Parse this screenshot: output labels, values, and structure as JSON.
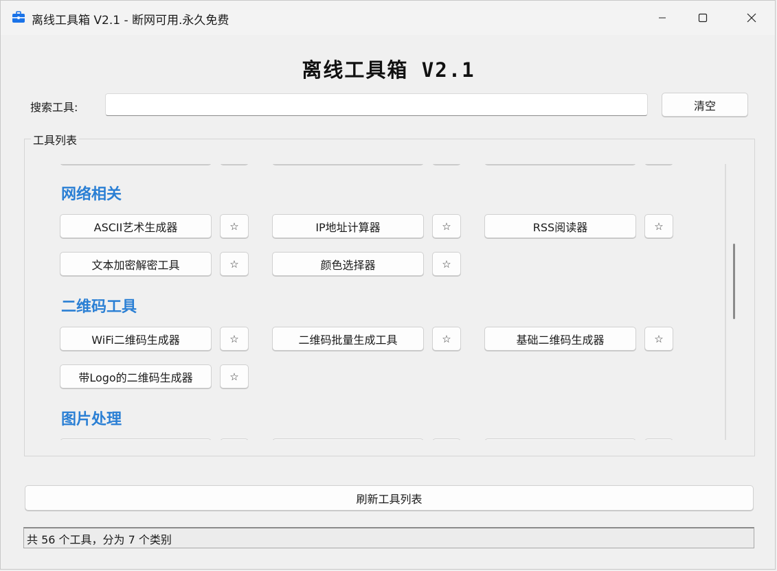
{
  "window": {
    "title": "离线工具箱 V2.1 - 断网可用.永久免费",
    "icon": "toolbox-icon",
    "accent": "#1a73e8"
  },
  "heading": "离线工具箱 V2.1",
  "search": {
    "label": "搜索工具:",
    "value": "",
    "placeholder": ""
  },
  "clear_label": "清空",
  "group_title": "工具列表",
  "categories": [
    {
      "name": "网络相关",
      "tools": [
        "ASCII艺术生成器",
        "IP地址计算器",
        "RSS阅读器",
        "文本加密解密工具",
        "颜色选择器"
      ]
    },
    {
      "name": "二维码工具",
      "tools": [
        "WiFi二维码生成器",
        "二维码批量生成工具",
        "基础二维码生成器",
        "带Logo的二维码生成器"
      ]
    },
    {
      "name": "图片处理",
      "tools": []
    }
  ],
  "favorite_symbol": "☆",
  "category_color": "#2a7fd4",
  "refresh_label": "刷新工具列表",
  "status_text": "共 56 个工具，分为 7 个类别"
}
